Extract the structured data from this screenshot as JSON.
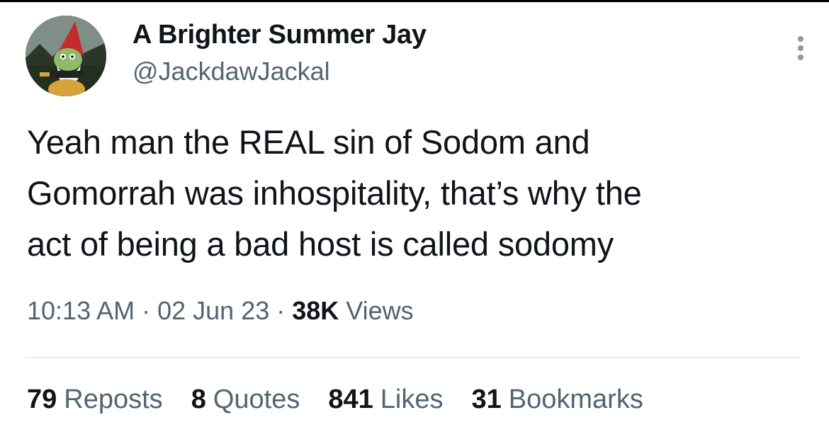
{
  "author": {
    "display_name": "A Brighter Summer Jay",
    "handle": "@JackdawJackal",
    "avatar_icon": "gnome-avatar-icon"
  },
  "tweet": {
    "lines": [
      "Yeah man the REAL sin of Sodom and",
      "Gomorrah was inhospitality, that’s why the",
      "act of being a bad host is called sodomy"
    ]
  },
  "meta": {
    "time": "10:13 AM",
    "sep1": " · ",
    "date": "02 Jun 23",
    "sep2": " · ",
    "views_count": "38K",
    "views_label": " Views"
  },
  "stats": {
    "reposts": {
      "count": "79",
      "label": "Reposts"
    },
    "quotes": {
      "count": "8",
      "label": "Quotes"
    },
    "likes": {
      "count": "841",
      "label": "Likes"
    },
    "bookmarks": {
      "count": "31",
      "label": "Bookmarks"
    }
  },
  "more_icon": "more-dots-icon",
  "colors": {
    "text": "#0f1419",
    "secondary": "#536471",
    "divider": "#d7dde2"
  }
}
